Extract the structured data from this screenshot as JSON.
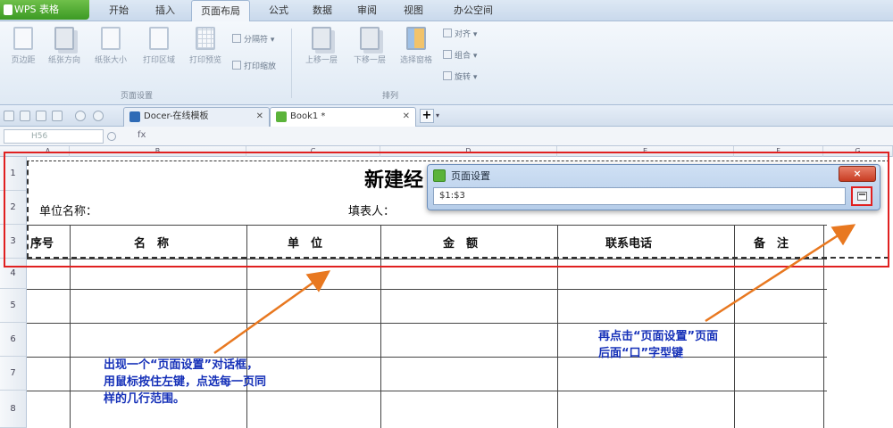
{
  "app": {
    "name": "WPS 表格",
    "accent": "#4aa52c"
  },
  "menu": {
    "items": [
      "开始",
      "插入",
      "页面布局",
      "公式",
      "数据",
      "审阅",
      "视图",
      "办公空间"
    ],
    "active": "页面布局"
  },
  "ribbon": {
    "page_setup": {
      "buttons": [
        "页边距",
        "纸张方向",
        "纸张大小",
        "打印区域",
        "打印预览"
      ],
      "small": [
        "分隔符",
        "打印缩放"
      ],
      "label": "页面设置"
    },
    "arrange": {
      "buttons": [
        "上移一层",
        "下移一层",
        "选择窗格"
      ],
      "small": [
        "对齐",
        "组合",
        "旋转"
      ],
      "label": "排列"
    }
  },
  "tabs": {
    "doc1": "Docer-在线模板",
    "doc2": "Book1 *",
    "add": "+"
  },
  "formula_bar": {
    "name_box": "H56",
    "fx": "fx"
  },
  "columns": [
    "A",
    "B",
    "C",
    "D",
    "E",
    "F",
    "G"
  ],
  "rows": [
    "1",
    "2",
    "3",
    "4",
    "5",
    "6",
    "7",
    "8"
  ],
  "sheet": {
    "title": "新建经",
    "unit_name_label": "单位名称：",
    "filler_label": "填表人：",
    "headers": [
      "序号",
      "名　称",
      "单　位",
      "金　额",
      "联系电话",
      "备　注"
    ]
  },
  "dialog": {
    "title": "页面设置",
    "input_value": "$1:$3",
    "close": "×"
  },
  "annotations": {
    "left": [
      "出现一个“页面设置”对话框，",
      "用鼠标按住左键，点选每一页同",
      "样的几行范围。"
    ],
    "right": [
      "再点击“页面设置”页面",
      "后面“口”字型键"
    ]
  },
  "colors": {
    "highlight_red": "#e02020",
    "arrow_orange": "#e87820",
    "annotation_blue": "#1530b8"
  }
}
